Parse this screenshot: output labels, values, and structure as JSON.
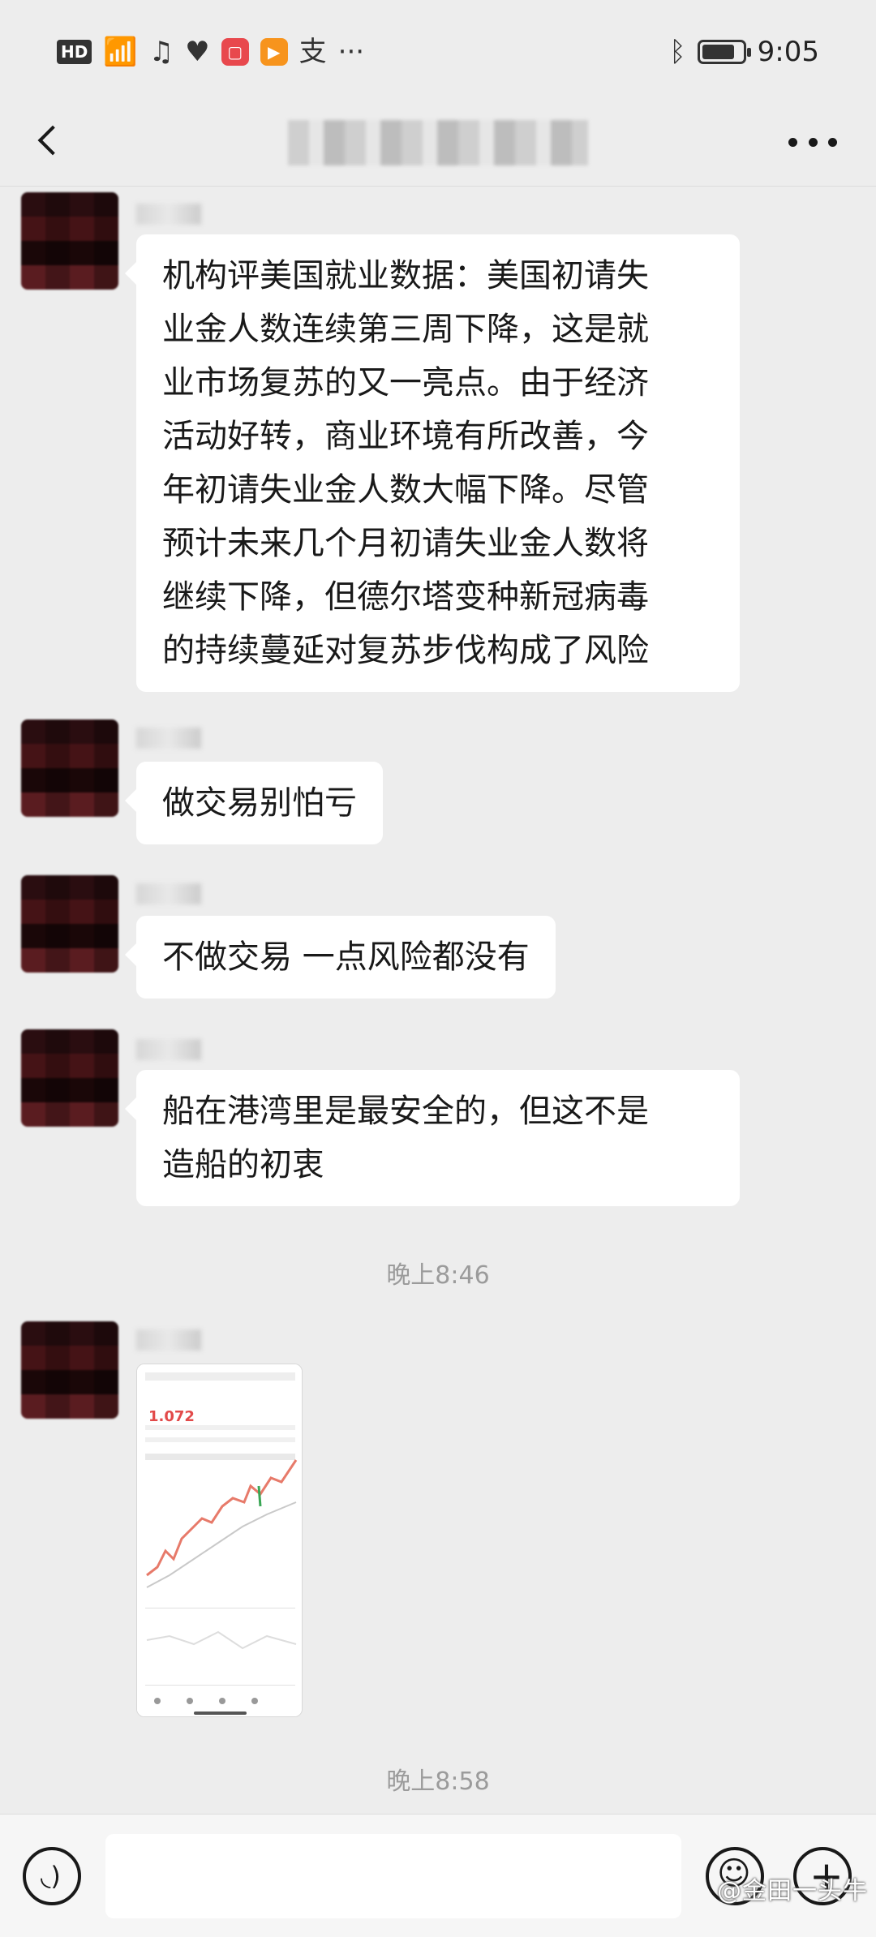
{
  "status_bar": {
    "hd_label": "HD",
    "icons": [
      "signal-icon",
      "music-icon",
      "heart-icon",
      "red-app-icon",
      "video-app-icon",
      "alipay-icon",
      "more-notifications-icon"
    ],
    "alipay_glyph": "支",
    "more_glyph": "···",
    "time": "9:05",
    "battery_level": 0.72
  },
  "header": {
    "title": "",
    "back_icon": "chevron-left-icon",
    "more_icon": "more-dots-icon"
  },
  "messages": [
    {
      "type": "text",
      "text": "机构评美国就业数据：美国初请失\n业金人数连续第三周下降，这是就\n业市场复苏的又一亮点。由于经济\n活动好转，商业环境有所改善，今\n年初请失业金人数大幅下降。尽管\n预计未来几个月初请失业金人数将\n继续下降，但德尔塔变种新冠病毒\n的持续蔓延对复苏步伐构成了风险"
    },
    {
      "type": "text",
      "text": "做交易别怕亏"
    },
    {
      "type": "text",
      "text": "不做交易 一点风险都没有"
    },
    {
      "type": "text",
      "text": "船在港湾里是最安全的，但这不是\n造船的初衷"
    },
    {
      "type": "image",
      "preview_price": "1.072"
    }
  ],
  "time_labels": [
    "晚上8:46",
    "晚上8:58"
  ],
  "input_bar": {
    "placeholder": "",
    "voice_icon": "voice-icon",
    "emoji_icon": "emoji-icon",
    "plus_icon": "plus-icon"
  },
  "watermark": "@金田一头牛"
}
